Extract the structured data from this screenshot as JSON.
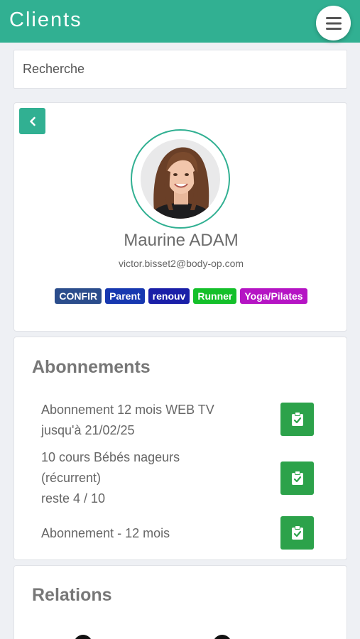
{
  "header": {
    "title": "Clients",
    "menu_icon": "hamburger-menu-icon"
  },
  "search": {
    "placeholder": "Recherche"
  },
  "profile": {
    "back_icon": "chevron-left-icon",
    "name": "Maurine ADAM",
    "email": "victor.bisset2@body-op.com",
    "tags": [
      {
        "label": "CONFIR",
        "color": "#2b4d8c"
      },
      {
        "label": "Parent",
        "color": "#1738b0"
      },
      {
        "label": "renouv",
        "color": "#1a1fa8"
      },
      {
        "label": "Runner",
        "color": "#14c02a"
      },
      {
        "label": "Yoga/Pilates",
        "color": "#b514c4"
      }
    ]
  },
  "subscriptions": {
    "title": "Abonnements",
    "items": [
      {
        "line1": "Abonnement 12 mois WEB TV",
        "line2": "jusqu'à 21/02/25",
        "icon": "clipboard-check-icon"
      },
      {
        "line1": "10 cours Bébés nageurs",
        "line1b": "(récurrent)",
        "line2": "reste 4 / 10",
        "icon": "clipboard-check-icon"
      },
      {
        "line1": "Abonnement - 12 mois",
        "icon": "clipboard-check-icon"
      }
    ]
  },
  "relations": {
    "title": "Relations"
  },
  "colors": {
    "accent": "#31b092",
    "action_green": "#2ca24a",
    "background": "#eef0f4"
  }
}
